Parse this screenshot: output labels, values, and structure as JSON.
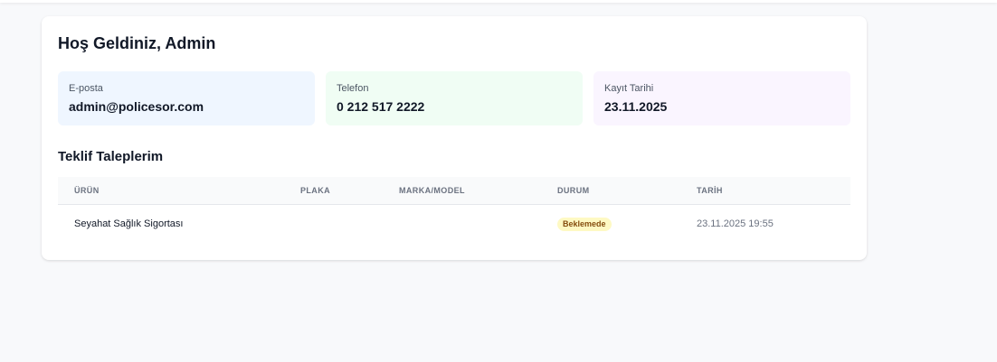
{
  "welcome": "Hoş Geldiniz, Admin",
  "info": {
    "email": {
      "label": "E-posta",
      "value": "admin@policesor.com"
    },
    "phone": {
      "label": "Telefon",
      "value": "0 212 517 2222"
    },
    "date": {
      "label": "Kayıt Tarihi",
      "value": "23.11.2025"
    }
  },
  "requests": {
    "title": "Teklif Taleplerim",
    "columns": [
      "ÜRÜN",
      "PLAKA",
      "MARKA/MODEL",
      "DURUM",
      "TARİH"
    ],
    "rows": [
      {
        "product": "Seyahat Sağlık Sigortası",
        "plate": "",
        "brand_model": "",
        "status": "Beklemede",
        "date": "23.11.2025 19:55"
      }
    ]
  },
  "colors": {
    "email_box": "#eff6ff",
    "phone_box": "#f0fdf4",
    "date_box": "#faf5ff",
    "status_pending_bg": "#fef9c3",
    "status_pending_text": "#854d0e"
  }
}
